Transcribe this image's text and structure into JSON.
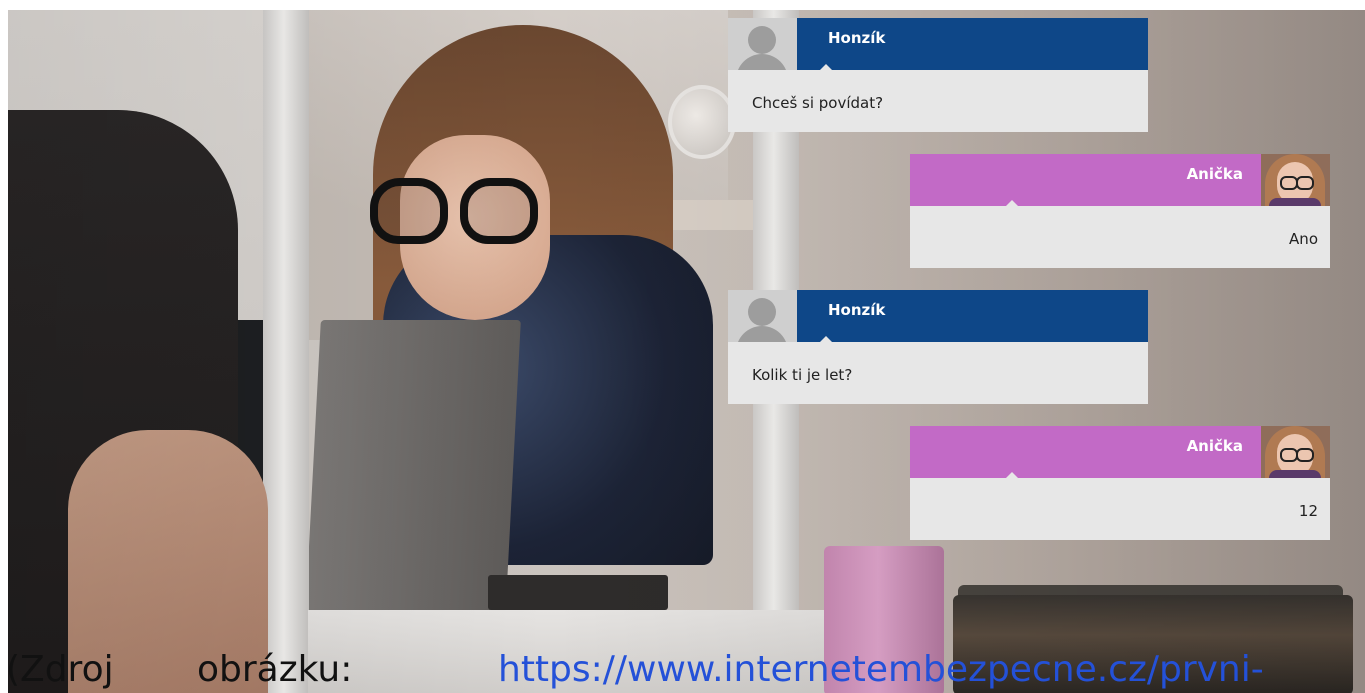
{
  "video": {
    "description_alt": ""
  },
  "chat": {
    "messages": [
      {
        "sender": "Honzík",
        "text": "Chceš si povídat?",
        "side": "left",
        "avatar": "generic-user-icon",
        "color": "#0e4788"
      },
      {
        "sender": "Anička",
        "text": "Ano",
        "side": "right",
        "avatar": "girl-photo",
        "color": "#c26ac6"
      },
      {
        "sender": "Honzík",
        "text": "Kolik ti je let?",
        "side": "left",
        "avatar": "generic-user-icon",
        "color": "#0e4788"
      },
      {
        "sender": "Anička",
        "text": "12",
        "side": "right",
        "avatar": "girl-photo",
        "color": "#c26ac6"
      }
    ]
  },
  "caption": {
    "word1": "(Zdroj",
    "word2": "obrázku:",
    "link_text": "https://www.internetembezpecne.cz/prvni-"
  },
  "colors": {
    "sender_bar": "#0e4788",
    "receiver_bar": "#c26ac6",
    "message_body": "#e7e7e7",
    "link": "#2451d8"
  }
}
